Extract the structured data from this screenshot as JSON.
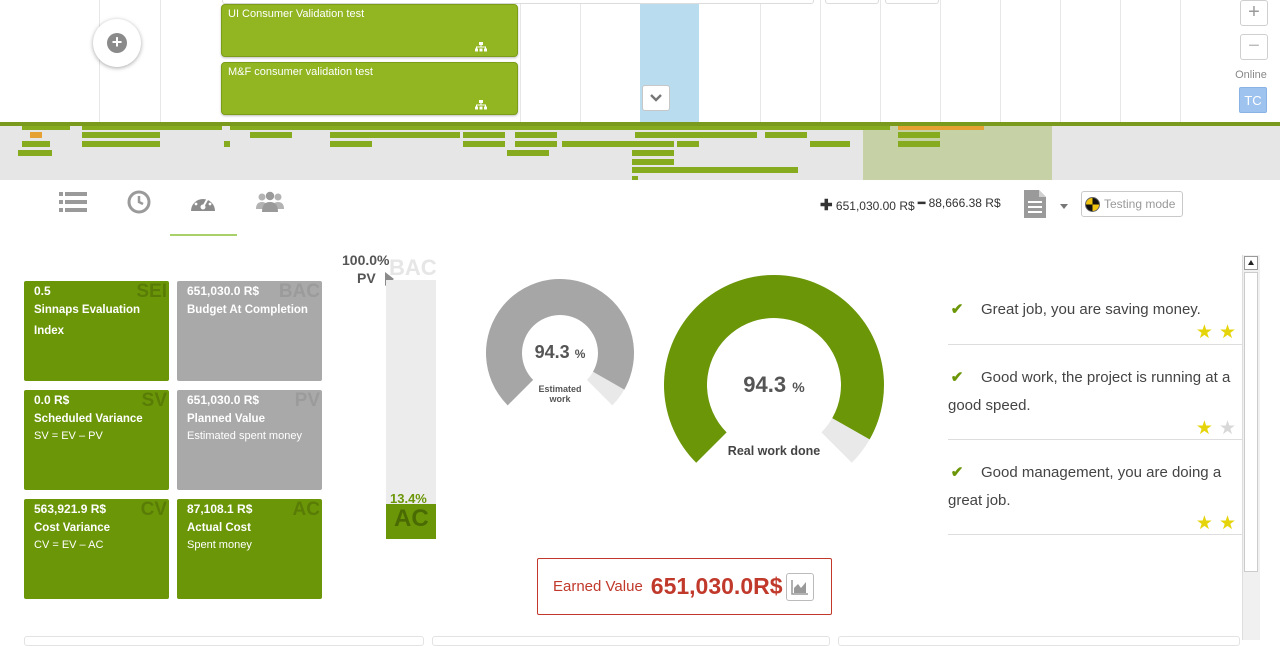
{
  "gantt": {
    "tasks": [
      {
        "name": "UI Consumer Validation test",
        "icon": "hierarchy-icon"
      },
      {
        "name": "M&F consumer validation test",
        "icon": "hierarchy-icon"
      }
    ],
    "add_icon": "plus-circle-icon",
    "expand_icon": "chevron-down-icon",
    "zoom_in_label": "+",
    "zoom_out_label": "−",
    "online_label": "Online",
    "user_initials": "TC",
    "today_color": "#b9dcee"
  },
  "toolbar": {
    "tabs": [
      {
        "icon": "list-icon"
      },
      {
        "icon": "clock-icon"
      },
      {
        "icon": "dashboard-icon",
        "active": true
      },
      {
        "icon": "team-icon"
      }
    ],
    "plus_sign": "✚",
    "plus_total": "651,030.00 R$",
    "minus_sign": "━",
    "minus_total": "88,666.38 R$",
    "report_icon": "document-icon",
    "testing_mode_label": "Testing mode"
  },
  "metrics": {
    "sei": {
      "abbr": "SEI",
      "value": "0.5",
      "title": "Sinnaps Evaluation Index"
    },
    "bac": {
      "abbr": "BAC",
      "value": "651,030.0 R$",
      "title": "Budget At Completion"
    },
    "sv": {
      "abbr": "SV",
      "value": "0.0 R$",
      "title": "Scheduled Variance",
      "sub": "SV = EV – PV"
    },
    "pv": {
      "abbr": "PV",
      "value": "651,030.0 R$",
      "title": "Planned Value",
      "sub": "Estimated spent money"
    },
    "cv": {
      "abbr": "CV",
      "value": "563,921.9 R$",
      "title": "Cost Variance",
      "sub": "CV = EV – AC"
    },
    "ac": {
      "abbr": "AC",
      "value": "87,108.1 R$",
      "title": "Actual Cost",
      "sub": "Spent money"
    }
  },
  "progress": {
    "pv_percent_label": "100.0%",
    "pv_label": "PV",
    "bac_label": "BAC",
    "ac_percent_label": "13.4%",
    "ac_label": "AC",
    "ac_fraction": 0.134
  },
  "gauges": {
    "estimated": {
      "value": "94.3",
      "unit": "%",
      "label_line1": "Estimated",
      "label_line2": "work",
      "fraction": 0.943,
      "color": "#a6a6a6"
    },
    "real": {
      "value": "94.3",
      "unit": "%",
      "label": "Real work done",
      "fraction": 0.943,
      "color": "#6b9608"
    }
  },
  "feedback": [
    {
      "text": "Great job, you are saving money.",
      "stars": 2,
      "max_stars": 2
    },
    {
      "text": "Good work, the project is running at a good speed.",
      "stars": 1,
      "max_stars": 2
    },
    {
      "text": "Good management, you are doing a great job.",
      "stars": 2,
      "max_stars": 2
    }
  ],
  "earned_value": {
    "label": "Earned Value",
    "value": "651,030.0R$",
    "icon": "area-chart-icon"
  },
  "colors": {
    "green": "#6b9608",
    "task_green": "#92b522",
    "gray": "#a9a9a9",
    "red": "#c0392b"
  }
}
